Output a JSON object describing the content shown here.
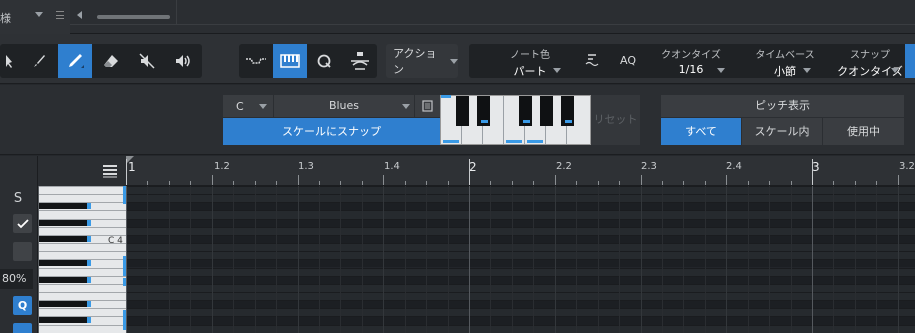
{
  "topbar": {
    "left_char": "様",
    "menu_icon": "menu-icon",
    "scroll_icon": "scroll-left-icon"
  },
  "toolbar": {
    "tools": [
      {
        "name": "arrow-tool",
        "icon": "cursor-arrow-icon",
        "active": false
      },
      {
        "name": "paint-tool",
        "icon": "paintbrush-icon",
        "active": false
      },
      {
        "name": "pencil-tool",
        "icon": "pencil-icon",
        "active": true
      },
      {
        "name": "eraser-tool",
        "icon": "eraser-icon",
        "active": false
      },
      {
        "name": "mute-tool",
        "icon": "mute-speaker-icon",
        "active": false
      },
      {
        "name": "listen-tool",
        "icon": "speaker-icon",
        "active": false
      }
    ],
    "view_tools": [
      {
        "name": "automation-view",
        "icon": "wave-line-icon",
        "active": false
      },
      {
        "name": "keyboard-view",
        "icon": "keyboard-icon",
        "active": true
      },
      {
        "name": "quantize-button",
        "icon": "q-icon",
        "active": false
      },
      {
        "name": "audition-button",
        "icon": "swing-icon",
        "active": false
      }
    ],
    "action_label": "アクション",
    "params": {
      "note_color_label": "ノート色",
      "note_color_value": "パート",
      "aq_label": "AQ",
      "quantize_label": "クオンタイズ",
      "quantize_value": "1/16",
      "timebase_label": "タイムベース",
      "timebase_value": "小節",
      "snap_label": "スナップ",
      "snap_value": "クオンタイズ"
    }
  },
  "scale": {
    "key": "C",
    "scale_name": "Blues",
    "snap_button": "スケールにスナップ",
    "reset_button": "リセット",
    "pitch_display_title": "ピッチ表示",
    "pitch_options": [
      "すべて",
      "スケール内",
      "使用中"
    ],
    "pitch_selected": "すべて"
  },
  "leftpanel": {
    "solo_label": "S",
    "zoom_percent": "80%",
    "q_label": "Q",
    "c4_label": "C 4"
  },
  "ruler": {
    "labels": [
      "1",
      "1.2",
      "1.3",
      "1.4",
      "2",
      "2.2",
      "2.3",
      "2.4",
      "3",
      "3.2"
    ]
  },
  "colors": {
    "accent": "#2f7fcf",
    "bg": "#25282c",
    "marker": "#3a9ae6"
  }
}
